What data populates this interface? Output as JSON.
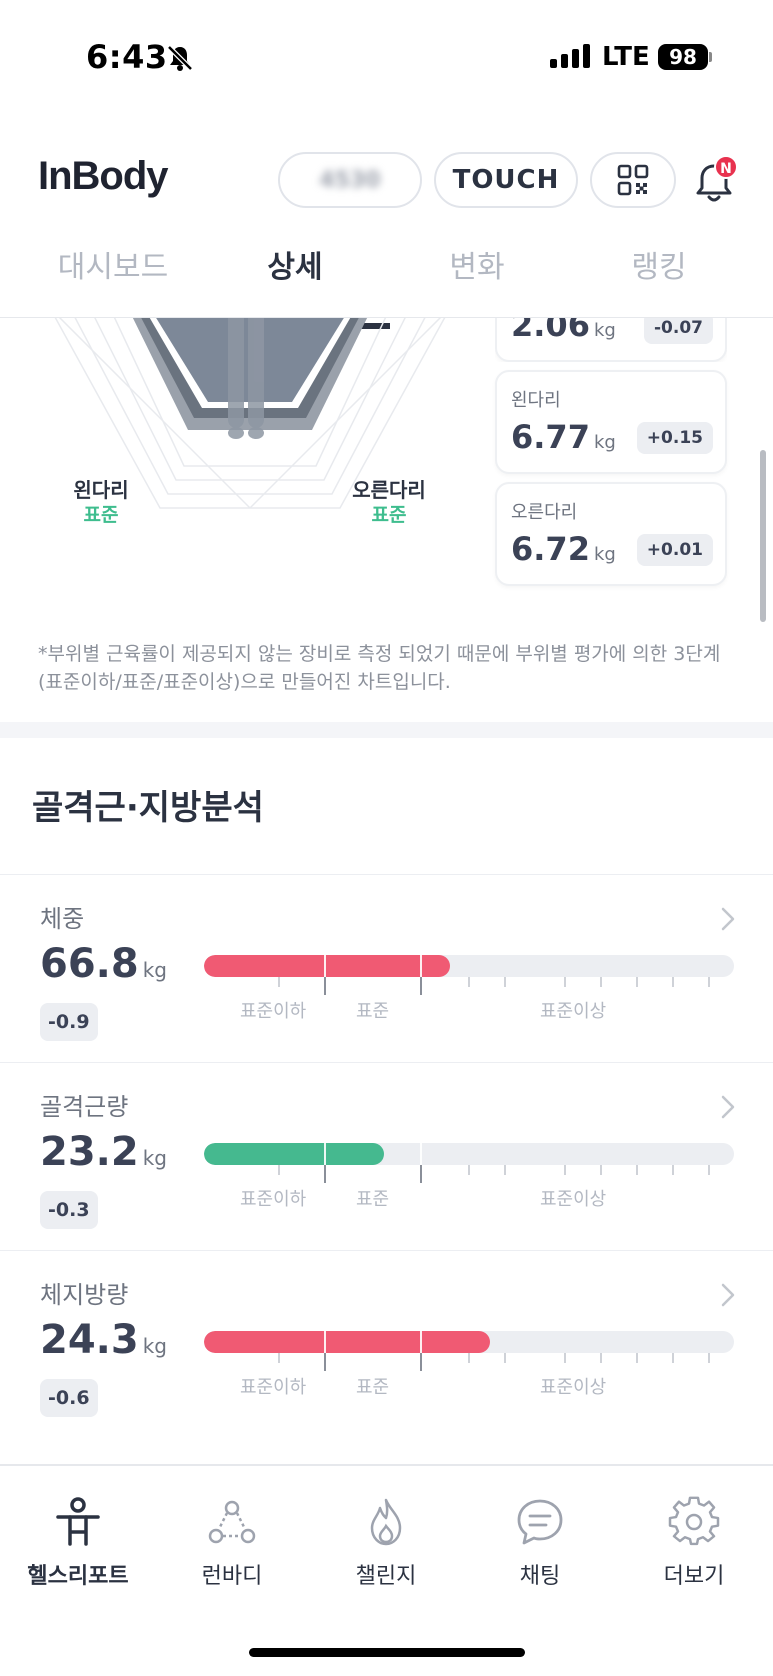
{
  "status": {
    "time": "6:43",
    "network": "LTE",
    "battery": "98"
  },
  "header": {
    "logo": "InBody",
    "id_blurred": "4530",
    "touch_label": "TOUCH",
    "notification_badge": "N"
  },
  "tabs": [
    {
      "label": "대시보드"
    },
    {
      "label": "상세"
    },
    {
      "label": "변화"
    },
    {
      "label": "랭킹"
    }
  ],
  "segment": {
    "left_leg_label": "왼다리",
    "left_leg_eval": "표준",
    "right_leg_label": "오른다리",
    "right_leg_eval": "표준",
    "cards": [
      {
        "name": "",
        "value": "2.06",
        "unit": "kg",
        "delta": "-0.07"
      },
      {
        "name": "왼다리",
        "value": "6.77",
        "unit": "kg",
        "delta": "+0.15"
      },
      {
        "name": "오른다리",
        "value": "6.72",
        "unit": "kg",
        "delta": "+0.01"
      }
    ],
    "note": "*부위별 근육률이 제공되지 않는 장비로 측정 되었기 때문에 부위별 평가에 의한 3단계(표준이하/표준/표준이상)으로 만들어진 차트입니다."
  },
  "analysis": {
    "title": "골격근·지방분석",
    "zones": {
      "below": "표준이하",
      "standard": "표준",
      "above": "표준이상"
    },
    "metrics": [
      {
        "label": "체중",
        "value": "66.8",
        "unit": "kg",
        "delta": "-0.9",
        "level_pct": 46.5,
        "color": "#f05a73"
      },
      {
        "label": "골격근량",
        "value": "23.2",
        "unit": "kg",
        "delta": "-0.3",
        "level_pct": 34,
        "color": "#45b98f"
      },
      {
        "label": "체지방량",
        "value": "24.3",
        "unit": "kg",
        "delta": "-0.6",
        "level_pct": 54,
        "color": "#f05a73"
      }
    ]
  },
  "nav": [
    {
      "label": "헬스리포트",
      "icon": "person-report-icon"
    },
    {
      "label": "런바디",
      "icon": "runbody-icon"
    },
    {
      "label": "챌린지",
      "icon": "flame-icon"
    },
    {
      "label": "채팅",
      "icon": "chat-icon"
    },
    {
      "label": "더보기",
      "icon": "gear-icon"
    }
  ]
}
